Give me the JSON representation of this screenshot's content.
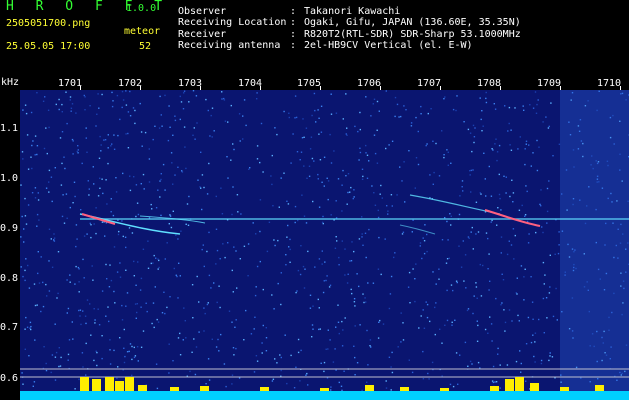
{
  "app": {
    "title": "H R O F F T",
    "version": "1.0.0"
  },
  "file": {
    "name": "2505051700.png",
    "datetime": "25.05.05 17:00"
  },
  "meteor": {
    "label": "meteor",
    "count": "52"
  },
  "station": [
    {
      "key": "Observer",
      "value": "Takanori Kawachi"
    },
    {
      "key": "Receiving Location",
      "value": "Ogaki, Gifu, JAPAN (136.60E, 35.35N)"
    },
    {
      "key": "Receiver",
      "value": "R820T2(RTL-SDR) SDR-Sharp 53.1000MHz"
    },
    {
      "key": "Receiving antenna",
      "value": "2el-HB9CV Vertical (el. E-W)"
    }
  ],
  "axes": {
    "y_unit": "kHz",
    "y_ticks": [
      "1.1",
      "1.0",
      "0.9",
      "0.8",
      "0.7",
      "0.6"
    ],
    "x_ticks": [
      "1701",
      "1702",
      "1703",
      "1704",
      "1705",
      "1706",
      "1707",
      "1708",
      "1709",
      "1710"
    ],
    "marker": "4"
  },
  "colors": {
    "background": "#0a1570",
    "noise": "#2a60d8",
    "trace": "#60e0ff",
    "meteor": "#ff6080",
    "histogram": "#ffee00",
    "baseline": "#00d0ff"
  }
}
